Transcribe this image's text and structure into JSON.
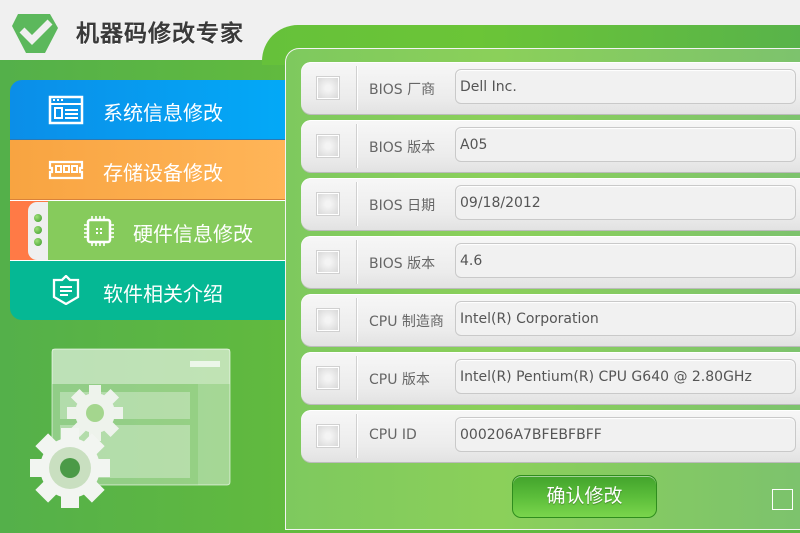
{
  "app": {
    "title": "机器码修改专家",
    "logo_icon": "checkmark-shield-icon"
  },
  "sidebar": {
    "items": [
      {
        "label": "系统信息修改",
        "icon": "window-icon",
        "color": "#0b8ee8",
        "active": false
      },
      {
        "label": "存储设备修改",
        "icon": "memory-chip-icon",
        "color": "#f8a441",
        "active": false
      },
      {
        "label": "硬件信息修改",
        "icon": "cpu-icon",
        "color": "#86cb5c",
        "active": true
      },
      {
        "label": "软件相关介绍",
        "icon": "shield-document-icon",
        "color": "#05b894",
        "active": false
      }
    ]
  },
  "fields": [
    {
      "label": "BIOS 厂商",
      "value": "Dell Inc.",
      "checked": false
    },
    {
      "label": "BIOS 版本",
      "value": "A05",
      "checked": false
    },
    {
      "label": "BIOS 日期",
      "value": "09/18/2012",
      "checked": false
    },
    {
      "label": "BIOS 版本",
      "value": "4.6",
      "checked": false
    },
    {
      "label": "CPU 制造商",
      "value": "Intel(R) Corporation",
      "checked": false
    },
    {
      "label": "CPU 版本",
      "value": "Intel(R) Pentium(R) CPU G640 @ 2.80GHz",
      "checked": false
    },
    {
      "label": "CPU ID",
      "value": "000206A7BFEBFBFF",
      "checked": false
    }
  ],
  "actions": {
    "confirm_label": "确认修改",
    "select_all_checked": false
  },
  "colors": {
    "accent_green": "#5cb54a",
    "panel_green": "#86cb5c",
    "active_marker": "#ff7a46"
  }
}
